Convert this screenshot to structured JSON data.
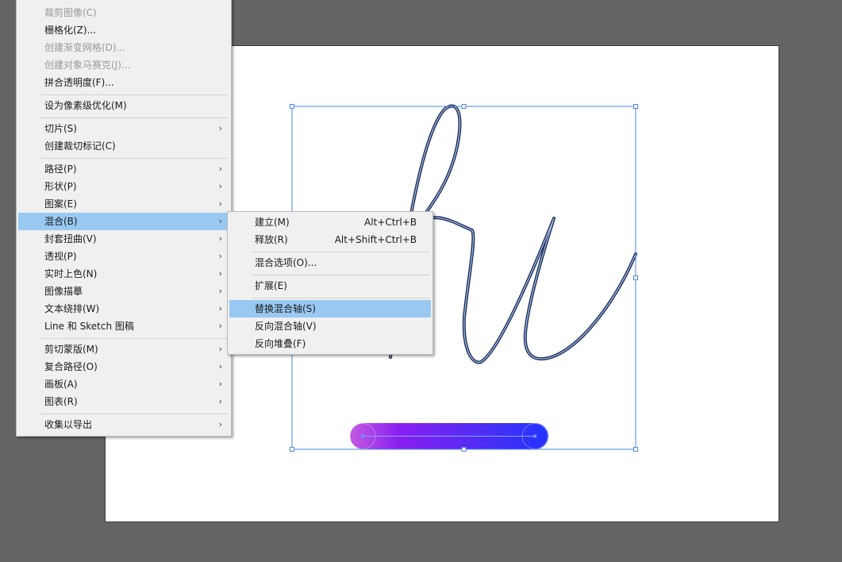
{
  "main_menu": {
    "items": [
      {
        "label": "裁剪图像(C)",
        "disabled": true,
        "submenu": false
      },
      {
        "label": "栅格化(Z)...",
        "disabled": false,
        "submenu": false
      },
      {
        "label": "创建渐变网格(D)...",
        "disabled": true,
        "submenu": false
      },
      {
        "label": "创建对象马赛克(J)...",
        "disabled": true,
        "submenu": false
      },
      {
        "label": "拼合透明度(F)...",
        "disabled": false,
        "submenu": false
      },
      {
        "label": "设为像素级优化(M)",
        "disabled": false,
        "submenu": false
      },
      {
        "label": "切片(S)",
        "disabled": false,
        "submenu": true
      },
      {
        "label": "创建裁切标记(C)",
        "disabled": false,
        "submenu": false
      },
      {
        "label": "路径(P)",
        "disabled": false,
        "submenu": true
      },
      {
        "label": "形状(P)",
        "disabled": false,
        "submenu": true
      },
      {
        "label": "图案(E)",
        "disabled": false,
        "submenu": true
      },
      {
        "label": "混合(B)",
        "disabled": false,
        "submenu": true,
        "highlighted": true
      },
      {
        "label": "封套扭曲(V)",
        "disabled": false,
        "submenu": true
      },
      {
        "label": "透视(P)",
        "disabled": false,
        "submenu": true
      },
      {
        "label": "实时上色(N)",
        "disabled": false,
        "submenu": true
      },
      {
        "label": "图像描摹",
        "disabled": false,
        "submenu": true
      },
      {
        "label": "文本绕排(W)",
        "disabled": false,
        "submenu": true
      },
      {
        "label": "Line 和 Sketch 图稿",
        "disabled": false,
        "submenu": true
      },
      {
        "label": "剪切蒙版(M)",
        "disabled": false,
        "submenu": true
      },
      {
        "label": "复合路径(O)",
        "disabled": false,
        "submenu": true
      },
      {
        "label": "画板(A)",
        "disabled": false,
        "submenu": true
      },
      {
        "label": "图表(R)",
        "disabled": false,
        "submenu": true
      },
      {
        "label": "收集以导出",
        "disabled": false,
        "submenu": true
      }
    ],
    "submenu_arrow": "›"
  },
  "blend_submenu": {
    "items": [
      {
        "label": "建立(M)",
        "shortcut": "Alt+Ctrl+B"
      },
      {
        "label": "释放(R)",
        "shortcut": "Alt+Shift+Ctrl+B"
      },
      {
        "label": "混合选项(O)...",
        "shortcut": ""
      },
      {
        "label": "扩展(E)",
        "shortcut": ""
      },
      {
        "label": "替换混合轴(S)",
        "shortcut": "",
        "highlighted": true
      },
      {
        "label": "反向混合轴(V)",
        "shortcut": ""
      },
      {
        "label": "反向堆叠(F)",
        "shortcut": ""
      }
    ]
  },
  "colors": {
    "workspace": "#646464",
    "menu_bg": "#f0f0f0",
    "highlight": "#99c9f2",
    "selection": "#4a86e8",
    "stroke": "#1d2d55",
    "gradient_start": "#b44fe8",
    "gradient_mid": "#7d1ff5",
    "gradient_end": "#2334ff"
  }
}
